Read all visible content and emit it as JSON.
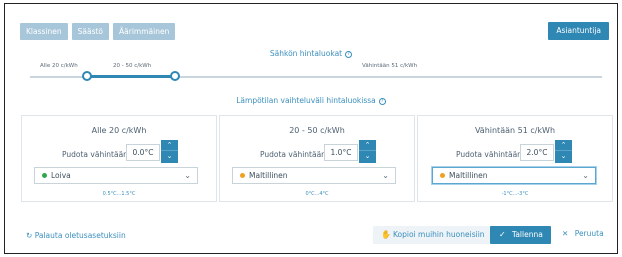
{
  "modes": [
    "Klassinen",
    "Säästö",
    "Äärimmäinen"
  ],
  "expert_label": "Asiantuntija",
  "electricity": {
    "title": "Sähkön hintaluokat",
    "labels": [
      "Alle 20 c/kWh",
      "20 - 50 c/kWh",
      "Vähintään 51 c/kWh"
    ]
  },
  "temp_title": "Lämpötilan vaihteluväli hintaluokissa",
  "drop_label": "Pudota vähintään",
  "panels": [
    {
      "title": "Alle 20 c/kWh",
      "value": "0.0°C",
      "option": "Loiva",
      "dot_color": "#2ea84f",
      "range": "0.5°C...1.5°C"
    },
    {
      "title": "20 - 50 c/kWh",
      "value": "1.0°C",
      "option": "Maltillinen",
      "dot_color": "#f0a020",
      "range": "0°C...4°C"
    },
    {
      "title": "Vähintään 51 c/kWh",
      "value": "2.0°C",
      "option": "Maltillinen",
      "dot_color": "#f0a020",
      "range": "-1°C...-3°C"
    }
  ],
  "footer": {
    "reset_label": "Palauta oletusasetuksiin",
    "copy_label": "Kopioi muihin huoneisiin",
    "save_label": "Tallenna",
    "cancel_label": "Peruuta"
  },
  "icons": {
    "info": "info-icon",
    "reset": "reset-icon",
    "copy": "copy-icon",
    "save": "check-icon",
    "cancel": "close-icon"
  }
}
